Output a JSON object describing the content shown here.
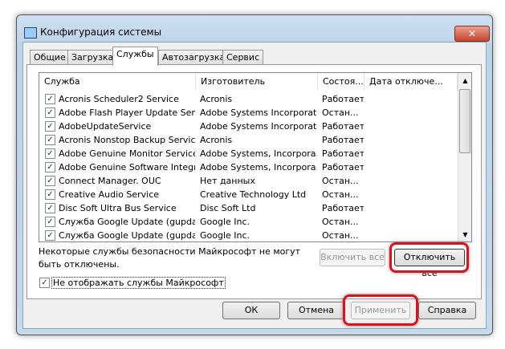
{
  "window": {
    "title": "Конфигурация системы",
    "close": "✕"
  },
  "tabs": [
    "Общие",
    "Загрузка",
    "Службы",
    "Автозагрузка",
    "Сервис"
  ],
  "columns": [
    "Служба",
    "Изготовитель",
    "Состоя...",
    "Дата отключе..."
  ],
  "rows": [
    [
      "Acronis Scheduler2 Service",
      "Acronis",
      "Работает"
    ],
    [
      "Adobe Flash Player Update Service",
      "Adobe Systems Incorporated",
      "Остан..."
    ],
    [
      "AdobeUpdateService",
      "Adobe Systems Incorporated",
      "Работает"
    ],
    [
      "Acronis Nonstop Backup Service",
      "Acronis",
      "Работает"
    ],
    [
      "Adobe Genuine Monitor Service",
      "Adobe Systems, Incorpora...",
      "Работает"
    ],
    [
      "Adobe Genuine Software Integri...",
      "Adobe Systems, Incorpora...",
      "Работает"
    ],
    [
      "Connect Manager. OUC",
      "Нет данных",
      "Остан..."
    ],
    [
      "Creative Audio Service",
      "Creative Technology Ltd",
      "Остан..."
    ],
    [
      "Disc Soft Ultra Bus Service",
      "Disc Soft Ltd",
      "Работает"
    ],
    [
      "Служба Google Update (gupdate)",
      "Google Inc.",
      "Остан..."
    ],
    [
      "Служба Google Update (gupdatem)",
      "Google Inc.",
      "Остан..."
    ]
  ],
  "note": "Некоторые службы безопасности Майкрософт не могут быть отключены.",
  "enable_all": "Включить все",
  "disable_all": "Отключить все",
  "hide_ms": "Не отображать службы Майкрософт",
  "ok": "ОК",
  "cancel": "Отмена",
  "apply": "Применить",
  "help": "Справка"
}
